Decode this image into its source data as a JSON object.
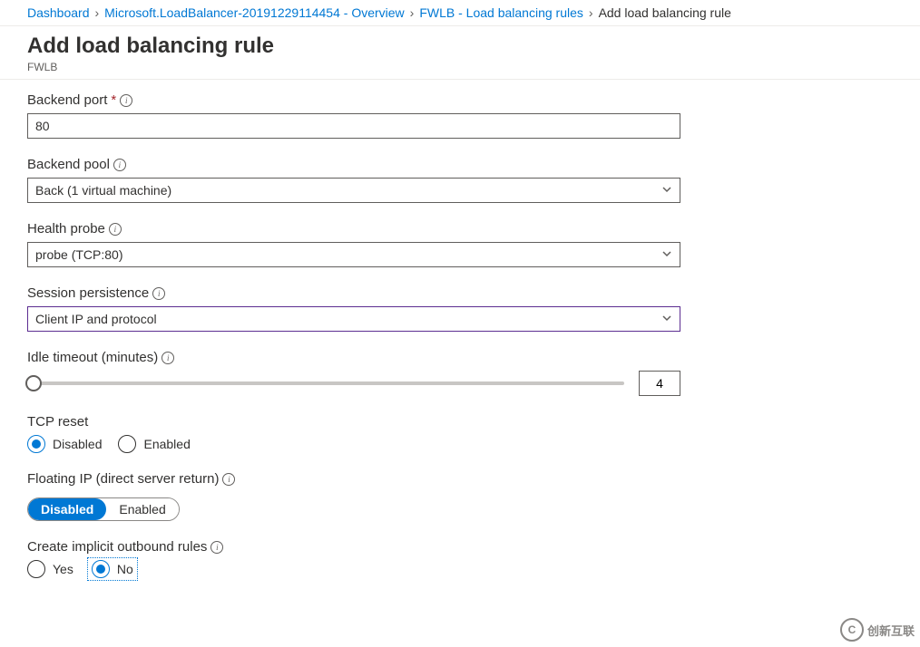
{
  "breadcrumb": {
    "items": [
      {
        "label": "Dashboard",
        "link": true
      },
      {
        "label": "Microsoft.LoadBalancer-20191229114454 - Overview",
        "link": true
      },
      {
        "label": "FWLB - Load balancing rules",
        "link": true
      },
      {
        "label": "Add load balancing rule",
        "link": false
      }
    ]
  },
  "header": {
    "title": "Add load balancing rule",
    "subtitle": "FWLB"
  },
  "form": {
    "backend_port": {
      "label": "Backend port",
      "required_marker": "*",
      "value": "80"
    },
    "backend_pool": {
      "label": "Backend pool",
      "value": "Back (1 virtual machine)"
    },
    "health_probe": {
      "label": "Health probe",
      "value": "probe (TCP:80)"
    },
    "session_persistence": {
      "label": "Session persistence",
      "value": "Client IP and protocol"
    },
    "idle_timeout": {
      "label": "Idle timeout (minutes)",
      "value": "4"
    },
    "tcp_reset": {
      "label": "TCP reset",
      "options": [
        "Disabled",
        "Enabled"
      ],
      "selected": "Disabled"
    },
    "floating_ip": {
      "label": "Floating IP (direct server return)",
      "options": [
        "Disabled",
        "Enabled"
      ],
      "selected": "Disabled"
    },
    "implicit_outbound": {
      "label": "Create implicit outbound rules",
      "options": [
        "Yes",
        "No"
      ],
      "selected": "No"
    }
  },
  "watermark": {
    "text": "创新互联"
  }
}
